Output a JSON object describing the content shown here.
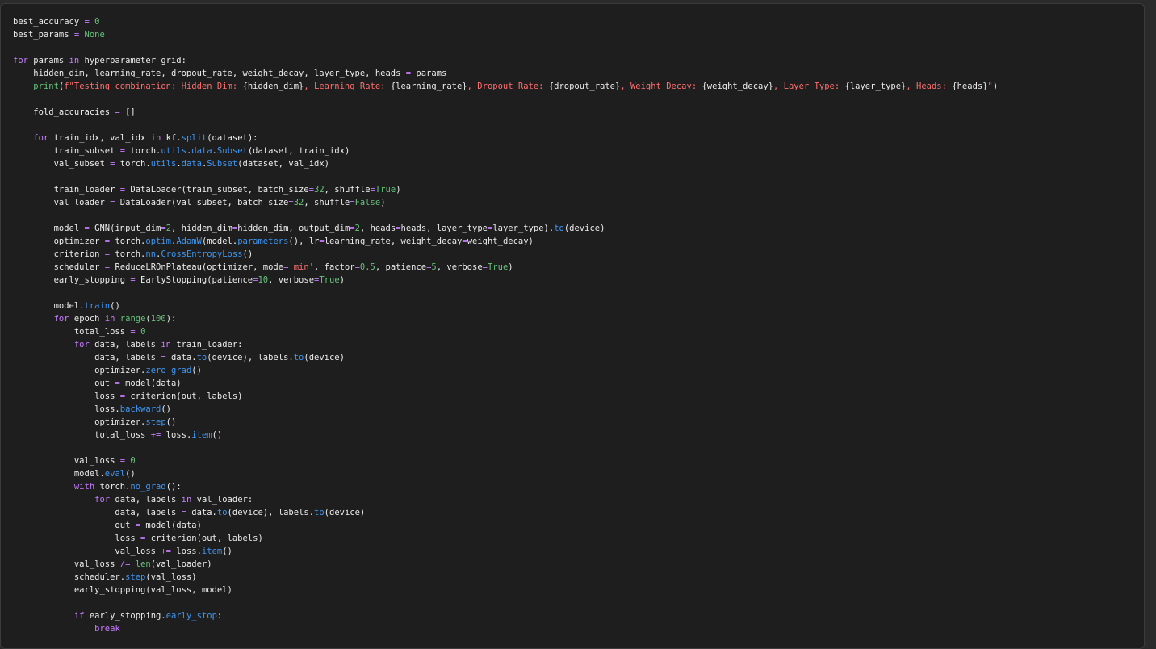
{
  "code": {
    "lines": [
      [
        [
          "plain",
          "best_accuracy "
        ],
        [
          "op",
          "="
        ],
        [
          "plain",
          " "
        ],
        [
          "num",
          "0"
        ]
      ],
      [
        [
          "plain",
          "best_params "
        ],
        [
          "op",
          "="
        ],
        [
          "plain",
          " "
        ],
        [
          "bool",
          "None"
        ]
      ],
      [],
      [
        [
          "kw",
          "for"
        ],
        [
          "plain",
          " params "
        ],
        [
          "kw",
          "in"
        ],
        [
          "plain",
          " hyperparameter_grid:"
        ]
      ],
      [
        [
          "plain",
          "    hidden_dim, learning_rate, dropout_rate, weight_decay, layer_type, heads "
        ],
        [
          "op",
          "="
        ],
        [
          "plain",
          " params"
        ]
      ],
      [
        [
          "plain",
          "    "
        ],
        [
          "bi",
          "print"
        ],
        [
          "plain",
          "("
        ],
        [
          "str",
          "f\"Testing combination: Hidden Dim: "
        ],
        [
          "plain",
          "{hidden_dim}"
        ],
        [
          "str",
          ", Learning Rate: "
        ],
        [
          "plain",
          "{learning_rate}"
        ],
        [
          "str",
          ", Dropout Rate: "
        ],
        [
          "plain",
          "{dropout_rate}"
        ],
        [
          "str",
          ", Weight Decay: "
        ],
        [
          "plain",
          "{weight_decay}"
        ],
        [
          "str",
          ", Layer Type: "
        ],
        [
          "plain",
          "{layer_type}"
        ],
        [
          "str",
          ", Heads: "
        ],
        [
          "plain",
          "{heads}"
        ],
        [
          "str",
          "\""
        ],
        [
          "plain",
          ")"
        ]
      ],
      [],
      [
        [
          "plain",
          "    fold_accuracies "
        ],
        [
          "op",
          "="
        ],
        [
          "plain",
          " []"
        ]
      ],
      [],
      [
        [
          "plain",
          "    "
        ],
        [
          "kw",
          "for"
        ],
        [
          "plain",
          " train_idx, val_idx "
        ],
        [
          "kw",
          "in"
        ],
        [
          "plain",
          " kf."
        ],
        [
          "fn",
          "split"
        ],
        [
          "plain",
          "(dataset):"
        ]
      ],
      [
        [
          "plain",
          "        train_subset "
        ],
        [
          "op",
          "="
        ],
        [
          "plain",
          " torch."
        ],
        [
          "fn",
          "utils"
        ],
        [
          "plain",
          "."
        ],
        [
          "fn",
          "data"
        ],
        [
          "plain",
          "."
        ],
        [
          "fn",
          "Subset"
        ],
        [
          "plain",
          "(dataset, train_idx)"
        ]
      ],
      [
        [
          "plain",
          "        val_subset "
        ],
        [
          "op",
          "="
        ],
        [
          "plain",
          " torch."
        ],
        [
          "fn",
          "utils"
        ],
        [
          "plain",
          "."
        ],
        [
          "fn",
          "data"
        ],
        [
          "plain",
          "."
        ],
        [
          "fn",
          "Subset"
        ],
        [
          "plain",
          "(dataset, val_idx)"
        ]
      ],
      [],
      [
        [
          "plain",
          "        train_loader "
        ],
        [
          "op",
          "="
        ],
        [
          "plain",
          " DataLoader(train_subset, batch_size"
        ],
        [
          "op",
          "="
        ],
        [
          "num",
          "32"
        ],
        [
          "plain",
          ", shuffle"
        ],
        [
          "op",
          "="
        ],
        [
          "bool",
          "True"
        ],
        [
          "plain",
          ")"
        ]
      ],
      [
        [
          "plain",
          "        val_loader "
        ],
        [
          "op",
          "="
        ],
        [
          "plain",
          " DataLoader(val_subset, batch_size"
        ],
        [
          "op",
          "="
        ],
        [
          "num",
          "32"
        ],
        [
          "plain",
          ", shuffle"
        ],
        [
          "op",
          "="
        ],
        [
          "bool",
          "False"
        ],
        [
          "plain",
          ")"
        ]
      ],
      [],
      [
        [
          "plain",
          "        model "
        ],
        [
          "op",
          "="
        ],
        [
          "plain",
          " GNN(input_dim"
        ],
        [
          "op",
          "="
        ],
        [
          "num",
          "2"
        ],
        [
          "plain",
          ", hidden_dim"
        ],
        [
          "op",
          "="
        ],
        [
          "plain",
          "hidden_dim, output_dim"
        ],
        [
          "op",
          "="
        ],
        [
          "num",
          "2"
        ],
        [
          "plain",
          ", heads"
        ],
        [
          "op",
          "="
        ],
        [
          "plain",
          "heads, layer_type"
        ],
        [
          "op",
          "="
        ],
        [
          "plain",
          "layer_type)."
        ],
        [
          "fn",
          "to"
        ],
        [
          "plain",
          "(device)"
        ]
      ],
      [
        [
          "plain",
          "        optimizer "
        ],
        [
          "op",
          "="
        ],
        [
          "plain",
          " torch."
        ],
        [
          "fn",
          "optim"
        ],
        [
          "plain",
          "."
        ],
        [
          "fn",
          "AdamW"
        ],
        [
          "plain",
          "(model."
        ],
        [
          "fn",
          "parameters"
        ],
        [
          "plain",
          "(), lr"
        ],
        [
          "op",
          "="
        ],
        [
          "plain",
          "learning_rate, weight_decay"
        ],
        [
          "op",
          "="
        ],
        [
          "plain",
          "weight_decay)"
        ]
      ],
      [
        [
          "plain",
          "        criterion "
        ],
        [
          "op",
          "="
        ],
        [
          "plain",
          " torch."
        ],
        [
          "fn",
          "nn"
        ],
        [
          "plain",
          "."
        ],
        [
          "fn",
          "CrossEntropyLoss"
        ],
        [
          "plain",
          "()"
        ]
      ],
      [
        [
          "plain",
          "        scheduler "
        ],
        [
          "op",
          "="
        ],
        [
          "plain",
          " ReduceLROnPlateau(optimizer, mode"
        ],
        [
          "op",
          "="
        ],
        [
          "str",
          "'min'"
        ],
        [
          "plain",
          ", factor"
        ],
        [
          "op",
          "="
        ],
        [
          "num",
          "0.5"
        ],
        [
          "plain",
          ", patience"
        ],
        [
          "op",
          "="
        ],
        [
          "num",
          "5"
        ],
        [
          "plain",
          ", verbose"
        ],
        [
          "op",
          "="
        ],
        [
          "bool",
          "True"
        ],
        [
          "plain",
          ")"
        ]
      ],
      [
        [
          "plain",
          "        early_stopping "
        ],
        [
          "op",
          "="
        ],
        [
          "plain",
          " EarlyStopping(patience"
        ],
        [
          "op",
          "="
        ],
        [
          "num",
          "10"
        ],
        [
          "plain",
          ", verbose"
        ],
        [
          "op",
          "="
        ],
        [
          "bool",
          "True"
        ],
        [
          "plain",
          ")"
        ]
      ],
      [],
      [
        [
          "plain",
          "        model."
        ],
        [
          "fn",
          "train"
        ],
        [
          "plain",
          "()"
        ]
      ],
      [
        [
          "plain",
          "        "
        ],
        [
          "kw",
          "for"
        ],
        [
          "plain",
          " epoch "
        ],
        [
          "kw",
          "in"
        ],
        [
          "plain",
          " "
        ],
        [
          "bi",
          "range"
        ],
        [
          "plain",
          "("
        ],
        [
          "num",
          "100"
        ],
        [
          "plain",
          "):"
        ]
      ],
      [
        [
          "plain",
          "            total_loss "
        ],
        [
          "op",
          "="
        ],
        [
          "plain",
          " "
        ],
        [
          "num",
          "0"
        ]
      ],
      [
        [
          "plain",
          "            "
        ],
        [
          "kw",
          "for"
        ],
        [
          "plain",
          " data, labels "
        ],
        [
          "kw",
          "in"
        ],
        [
          "plain",
          " train_loader:"
        ]
      ],
      [
        [
          "plain",
          "                data, labels "
        ],
        [
          "op",
          "="
        ],
        [
          "plain",
          " data."
        ],
        [
          "fn",
          "to"
        ],
        [
          "plain",
          "(device), labels."
        ],
        [
          "fn",
          "to"
        ],
        [
          "plain",
          "(device)"
        ]
      ],
      [
        [
          "plain",
          "                optimizer."
        ],
        [
          "fn",
          "zero_grad"
        ],
        [
          "plain",
          "()"
        ]
      ],
      [
        [
          "plain",
          "                out "
        ],
        [
          "op",
          "="
        ],
        [
          "plain",
          " model(data)"
        ]
      ],
      [
        [
          "plain",
          "                loss "
        ],
        [
          "op",
          "="
        ],
        [
          "plain",
          " criterion(out, labels)"
        ]
      ],
      [
        [
          "plain",
          "                loss."
        ],
        [
          "fn",
          "backward"
        ],
        [
          "plain",
          "()"
        ]
      ],
      [
        [
          "plain",
          "                optimizer."
        ],
        [
          "fn",
          "step"
        ],
        [
          "plain",
          "()"
        ]
      ],
      [
        [
          "plain",
          "                total_loss "
        ],
        [
          "op",
          "+="
        ],
        [
          "plain",
          " loss."
        ],
        [
          "fn",
          "item"
        ],
        [
          "plain",
          "()"
        ]
      ],
      [],
      [
        [
          "plain",
          "            val_loss "
        ],
        [
          "op",
          "="
        ],
        [
          "plain",
          " "
        ],
        [
          "num",
          "0"
        ]
      ],
      [
        [
          "plain",
          "            model."
        ],
        [
          "fn",
          "eval"
        ],
        [
          "plain",
          "()"
        ]
      ],
      [
        [
          "plain",
          "            "
        ],
        [
          "kw",
          "with"
        ],
        [
          "plain",
          " torch."
        ],
        [
          "fn",
          "no_grad"
        ],
        [
          "plain",
          "():"
        ]
      ],
      [
        [
          "plain",
          "                "
        ],
        [
          "kw",
          "for"
        ],
        [
          "plain",
          " data, labels "
        ],
        [
          "kw",
          "in"
        ],
        [
          "plain",
          " val_loader:"
        ]
      ],
      [
        [
          "plain",
          "                    data, labels "
        ],
        [
          "op",
          "="
        ],
        [
          "plain",
          " data."
        ],
        [
          "fn",
          "to"
        ],
        [
          "plain",
          "(device), labels."
        ],
        [
          "fn",
          "to"
        ],
        [
          "plain",
          "(device)"
        ]
      ],
      [
        [
          "plain",
          "                    out "
        ],
        [
          "op",
          "="
        ],
        [
          "plain",
          " model(data)"
        ]
      ],
      [
        [
          "plain",
          "                    loss "
        ],
        [
          "op",
          "="
        ],
        [
          "plain",
          " criterion(out, labels)"
        ]
      ],
      [
        [
          "plain",
          "                    val_loss "
        ],
        [
          "op",
          "+="
        ],
        [
          "plain",
          " loss."
        ],
        [
          "fn",
          "item"
        ],
        [
          "plain",
          "()"
        ]
      ],
      [
        [
          "plain",
          "            val_loss "
        ],
        [
          "op",
          "/="
        ],
        [
          "plain",
          " "
        ],
        [
          "bi",
          "len"
        ],
        [
          "plain",
          "(val_loader)"
        ]
      ],
      [
        [
          "plain",
          "            scheduler."
        ],
        [
          "fn",
          "step"
        ],
        [
          "plain",
          "(val_loss)"
        ]
      ],
      [
        [
          "plain",
          "            early_stopping(val_loss, model)"
        ]
      ],
      [],
      [
        [
          "plain",
          "            "
        ],
        [
          "kw",
          "if"
        ],
        [
          "plain",
          " early_stopping."
        ],
        [
          "fn",
          "early_stop"
        ],
        [
          "plain",
          ":"
        ]
      ],
      [
        [
          "plain",
          "                "
        ],
        [
          "kw",
          "break"
        ]
      ]
    ]
  }
}
